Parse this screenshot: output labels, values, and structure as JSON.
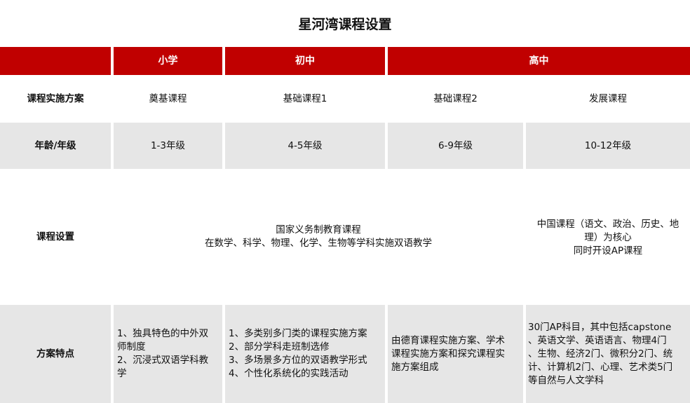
{
  "title": "星河湾课程设置",
  "header": {
    "primary": "小学",
    "middle": "初中",
    "high": "高中"
  },
  "rows": {
    "plan": {
      "label": "课程实施方案",
      "c1": "奠基课程",
      "c2": "基础课程1",
      "c3": "基础课程2",
      "c4": "发展课程"
    },
    "age": {
      "label": "年龄/年级",
      "c1": "1-3年级",
      "c2": "4-5年级",
      "c3": "6-9年级",
      "c4": "10-12年级"
    },
    "courses": {
      "label": "课程设置",
      "merged": [
        "国家义务制教育课程",
        "在数学、科学、物理、化学、生物等学科实施双语教学"
      ],
      "c4": [
        "中国课程（语文、政治、历史、地",
        "理）为核心",
        "同时开设AP课程"
      ]
    },
    "features": {
      "label": "方案特点",
      "c1": [
        "1、独具特色的中外双",
        "师制度",
        "2、沉浸式双语学科教",
        "学"
      ],
      "c2": [
        "1、多类别多门类的课程实施方案",
        "2、部分学科走班制选修",
        "3、多场景多方位的双语教学形式",
        "4、个性化系统化的实践活动"
      ],
      "c3": [
        "由德育课程实施方案、学术",
        "课程实施方案和探究课程实",
        "施方案组成"
      ],
      "c4": [
        "30门AP科目，其中包括capstone",
        "、英语文学、英语语言、物理4门",
        "、生物、经济2门、微积分2门、统",
        "计、计算机2门、心理、艺术类5门",
        "等自然与人文学科"
      ]
    }
  },
  "colors": {
    "header_red": "#c00000",
    "row_gray": "#e6e6e6"
  }
}
